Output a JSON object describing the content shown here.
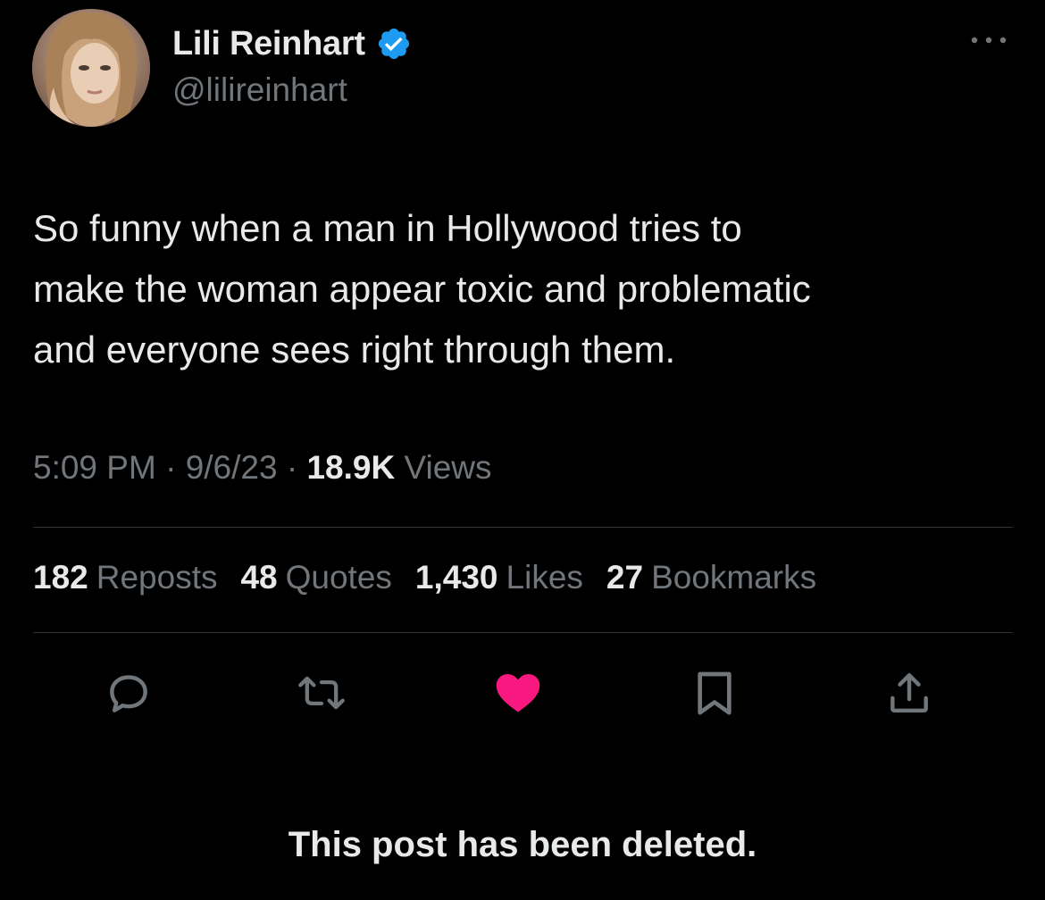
{
  "author": {
    "name": "Lili Reinhart",
    "handle": "@lilireinhart",
    "verified_color": "#1d9bf0"
  },
  "tweet": {
    "text": "So funny when a man in Hollywood tries to\nmake the woman appear toxic and problematic\nand everyone sees right through them."
  },
  "meta": {
    "time": "5:09 PM",
    "separator": "·",
    "date": "9/6/23",
    "views_count": "18.9K",
    "views_label": "Views"
  },
  "stats": [
    {
      "count": "182",
      "label": "Reposts"
    },
    {
      "count": "48",
      "label": "Quotes"
    },
    {
      "count": "1,430",
      "label": "Likes"
    },
    {
      "count": "27",
      "label": "Bookmarks"
    }
  ],
  "actions": {
    "reply_icon": "reply-icon",
    "repost_icon": "repost-icon",
    "like_icon": "heart-icon",
    "like_color": "#f91880",
    "bookmark_icon": "bookmark-icon",
    "share_icon": "share-icon",
    "icon_color": "#71767b"
  },
  "notice": "This post has been deleted."
}
